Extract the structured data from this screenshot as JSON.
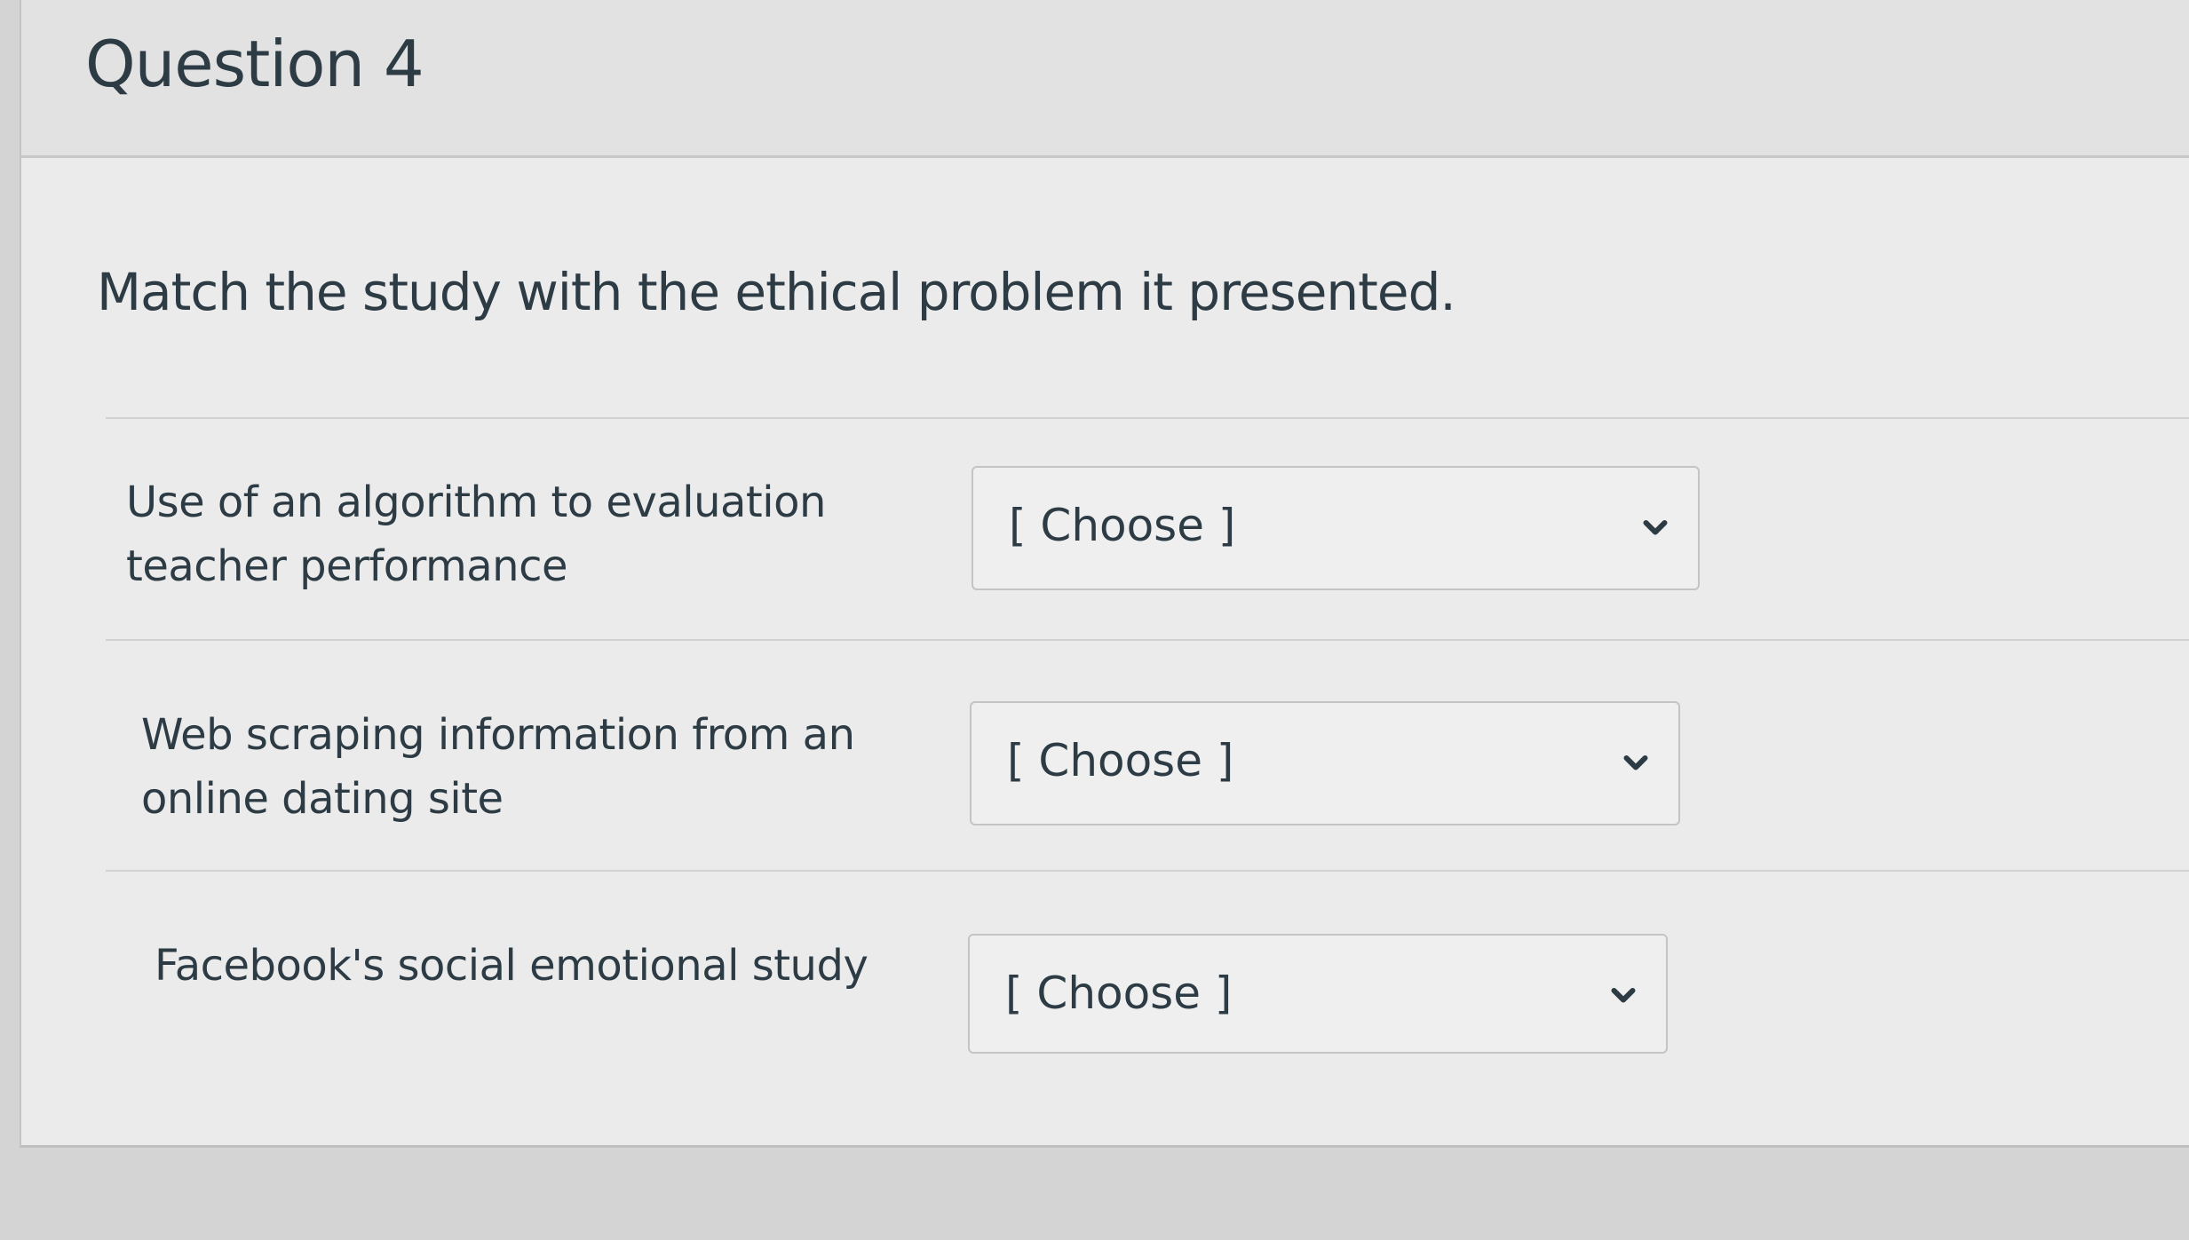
{
  "question": {
    "title": "Question 4",
    "prompt": "Match the study with the ethical problem it presented."
  },
  "matches": [
    {
      "label": "Use of an algorithm to evaluation teacher performance",
      "select_value": "[ Choose ]",
      "icon": "chevron-down-icon"
    },
    {
      "label": "Web scraping information from an online dating site",
      "select_value": "[ Choose ]",
      "icon": "chevron-down-icon"
    },
    {
      "label": "Facebook's social emotional study",
      "select_value": "[ Choose ]",
      "icon": "chevron-down-icon"
    }
  ]
}
